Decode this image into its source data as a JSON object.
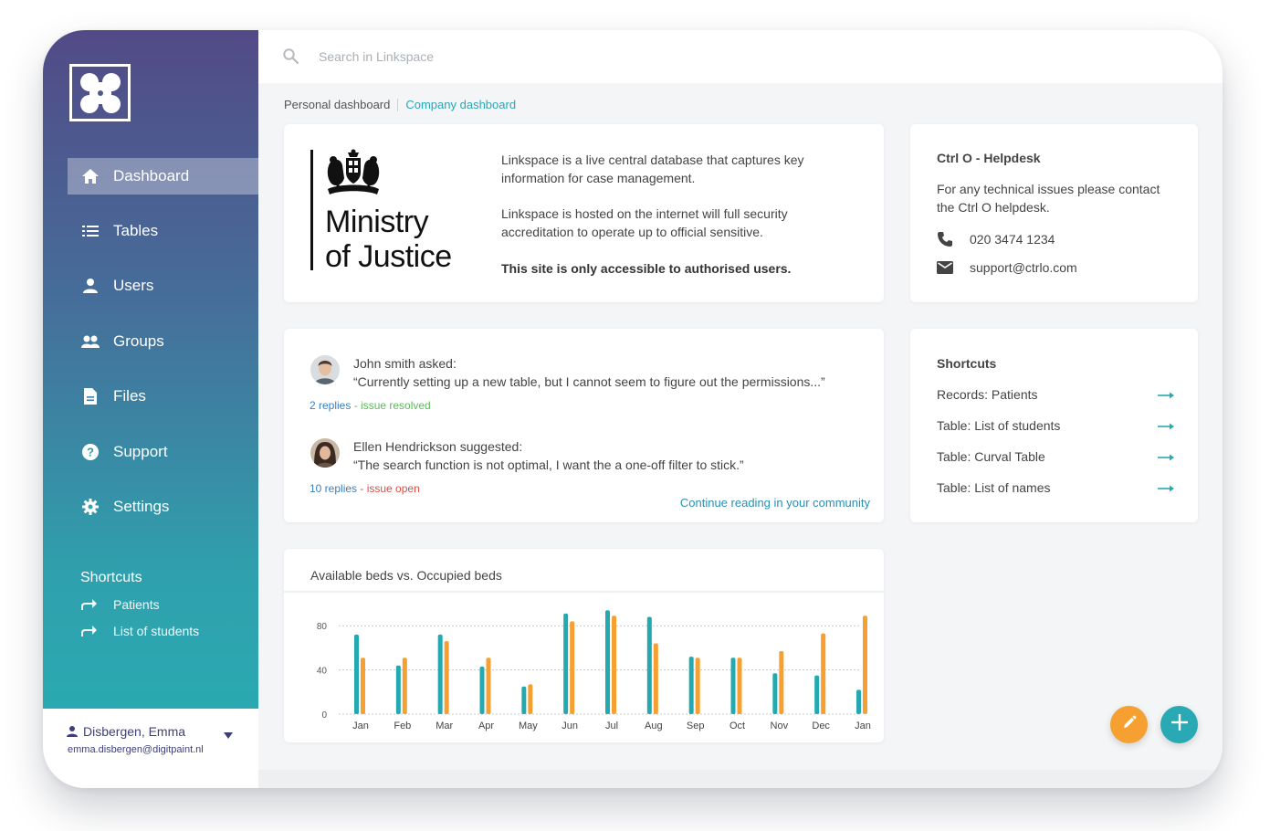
{
  "sidebar": {
    "nav": [
      {
        "label": "Dashboard",
        "icon": "home-icon",
        "active": true
      },
      {
        "label": "Tables",
        "icon": "list-icon"
      },
      {
        "label": "Users",
        "icon": "user-icon"
      },
      {
        "label": "Groups",
        "icon": "group-icon"
      },
      {
        "label": "Files",
        "icon": "file-icon"
      },
      {
        "label": "Support",
        "icon": "help-icon"
      },
      {
        "label": "Settings",
        "icon": "gear-icon"
      }
    ],
    "shortcuts_title": "Shortcuts",
    "shortcuts": [
      {
        "label": "Patients",
        "icon": "share-arrow-icon"
      },
      {
        "label": "List of students",
        "icon": "share-arrow-icon"
      }
    ],
    "user": {
      "name": "Disbergen, Emma",
      "email": "emma.disbergen@digitpaint.nl"
    }
  },
  "search": {
    "placeholder": "Search in Linkspace"
  },
  "breadcrumb": {
    "personal": "Personal dashboard",
    "company": "Company dashboard"
  },
  "info": {
    "logo_line1": "Ministry",
    "logo_line2": "of Justice",
    "p1": "Linkspace is a live central database that captures key information for case management.",
    "p2": "Linkspace is hosted on the internet will full security accreditation to operate up to official sensitive.",
    "p3": "This site is only accessible to authorised users."
  },
  "helpdesk": {
    "title": "Ctrl O - Helpdesk",
    "body": "For any technical issues please contact the Ctrl O helpdesk.",
    "phone": "020 3474 1234",
    "email": "support@ctrlo.com"
  },
  "community": {
    "posts": [
      {
        "label": "John smith asked:",
        "text": "“Currently setting up a new table, but I cannot seem to figure out the permissions...”",
        "replies": "2 replies",
        "status": " - issue resolved"
      },
      {
        "label": "Ellen Hendrickson suggested:",
        "text": "“The search function is not optimal, I want the a one-off filter to stick.”",
        "replies": "10 replies",
        "status": " - issue open"
      }
    ],
    "continue": "Continue reading in your community"
  },
  "shortcuts": {
    "title": "Shortcuts",
    "items": [
      "Records: Patients",
      "Table: List of students",
      "Table: Curval Table",
      "Table: List of names"
    ]
  },
  "chart_data": {
    "type": "bar",
    "title": "Available beds vs. Occupied beds",
    "categories": [
      "Jan",
      "Feb",
      "Mar",
      "Apr",
      "May",
      "Jun",
      "Jul",
      "Aug",
      "Sep",
      "Oct",
      "Nov",
      "Dec",
      "Jan"
    ],
    "series": [
      {
        "color": "#25a9b1",
        "values": [
          72,
          44,
          72,
          43,
          25,
          91,
          94,
          88,
          52,
          51,
          37,
          35,
          22
        ]
      },
      {
        "color": "#f5a030",
        "values": [
          51,
          51,
          66,
          51,
          27,
          84,
          89,
          64,
          51,
          51,
          57,
          73,
          89
        ]
      }
    ],
    "yticks": [
      0,
      40,
      80
    ],
    "ylim": [
      0,
      100
    ],
    "grid": true
  },
  "colors": {
    "accent_teal": "#2aa7b8",
    "accent_orange": "#f5a030"
  }
}
